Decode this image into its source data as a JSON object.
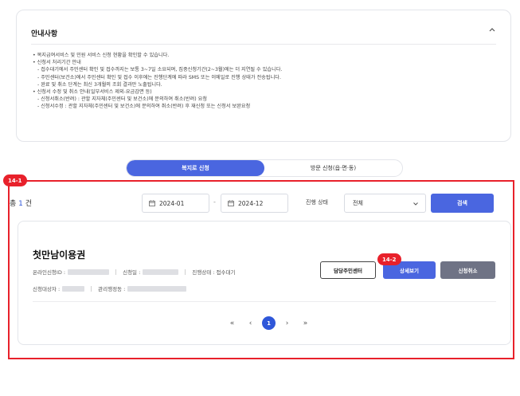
{
  "notice": {
    "title": "안내사항",
    "lines": [
      "• 복지급여서비스 및 민원 서비스 신청 현황을 확인할 수 있습니다.",
      "• 신청서 처리기간 안내",
      "- 접수대기에서 주민센터 확인 및 접수까지는 보통 3~7일 소요되며, 집중신청기간(2~3월)에는 더 지연될 수 있습니다.",
      "- 주민센터(보건소)에서 주민센터 확인 및 접수 이후에는 진행단계에 따라 SMS 또는 이메일로 진행 상태가 전송됩니다.",
      "- 완료 및 취소 단계는 최신 3개월의 조회 결과만 노출됩니다.",
      "• 신청서 수정 및 취소 안내(일부서비스 제외-요금감면 등)",
      "- 신청서취소(반려) : 관할 지자체(주민센터 및 보건소)에 문의하여 취소(반려) 요청",
      "- 신청서수정 : 관할 지자체(주민센터 및 보건소)에 문의하여 취소(반려) 후 재신청 또는 신청서 보완요청"
    ]
  },
  "tabs": [
    {
      "label": "복지로 신청",
      "active": true
    },
    {
      "label": "방문 신청(읍·면·동)",
      "active": false
    }
  ],
  "badges": {
    "frame": "14-1",
    "detail": "14-2"
  },
  "filter": {
    "total_prefix": "총 ",
    "total_count": "1",
    "total_suffix": " 건",
    "date_from": "2024-01",
    "date_sep": "-",
    "date_to": "2024-12",
    "status_label": "진행 상태",
    "status_value": "전체",
    "search_label": "검색"
  },
  "card": {
    "title": "첫만남이용권",
    "online_id_label": "온라인신청ID :",
    "apply_date_label": "신청일 :",
    "status_text": "진행상태 : 접수대기",
    "applicant_label": "신청대상자 :",
    "office_label": "관리행정동 :",
    "btn_center": "담당주민센터",
    "btn_detail": "상세보기",
    "btn_cancel": "신청취소"
  },
  "pagination": {
    "first": "«",
    "prev": "‹",
    "current": "1",
    "next": "›",
    "last": "»"
  },
  "colors": {
    "accent": "#4a66e0",
    "highlight_frame": "#e8212b",
    "cancel_button": "#6f7385"
  }
}
